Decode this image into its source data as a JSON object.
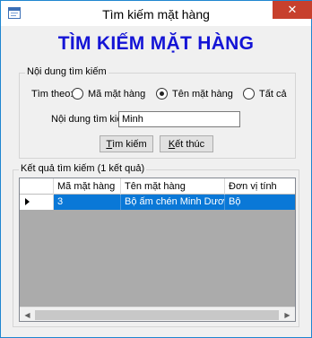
{
  "window": {
    "title": "Tìm kiếm mặt hàng",
    "close_glyph": "✕",
    "icon": "app-form-icon"
  },
  "heading": "TÌM KIẾM MẶT HÀNG",
  "search_group": {
    "legend": "Nội dung tìm kiếm",
    "search_by_label": "Tìm theo:",
    "options": [
      {
        "label": "Mã mặt hàng",
        "checked": false
      },
      {
        "label": "Tên mặt hàng",
        "checked": true
      },
      {
        "label": "Tất cả",
        "checked": false
      }
    ],
    "content_label": "Nội dung tìm kiếm",
    "content_value": "Minh",
    "search_button": {
      "mnemonic": "T",
      "rest": "ìm kiếm"
    },
    "exit_button": {
      "mnemonic": "K",
      "rest": "ết thúc"
    }
  },
  "results_group": {
    "legend": "Kết quả tìm kiếm (1 kết quả)",
    "columns": [
      "Mã mặt hàng",
      "Tên mặt hàng",
      "Đơn vị tính"
    ],
    "rows": [
      [
        "3",
        "Bộ ấm chén Minh Dương",
        "Bộ"
      ]
    ],
    "selected_row": 0,
    "scroll_left_glyph": "◀",
    "scroll_right_glyph": "▶"
  },
  "colors": {
    "heading": "#1414d6",
    "selection": "#0a78d7",
    "close_button": "#c7402d"
  }
}
